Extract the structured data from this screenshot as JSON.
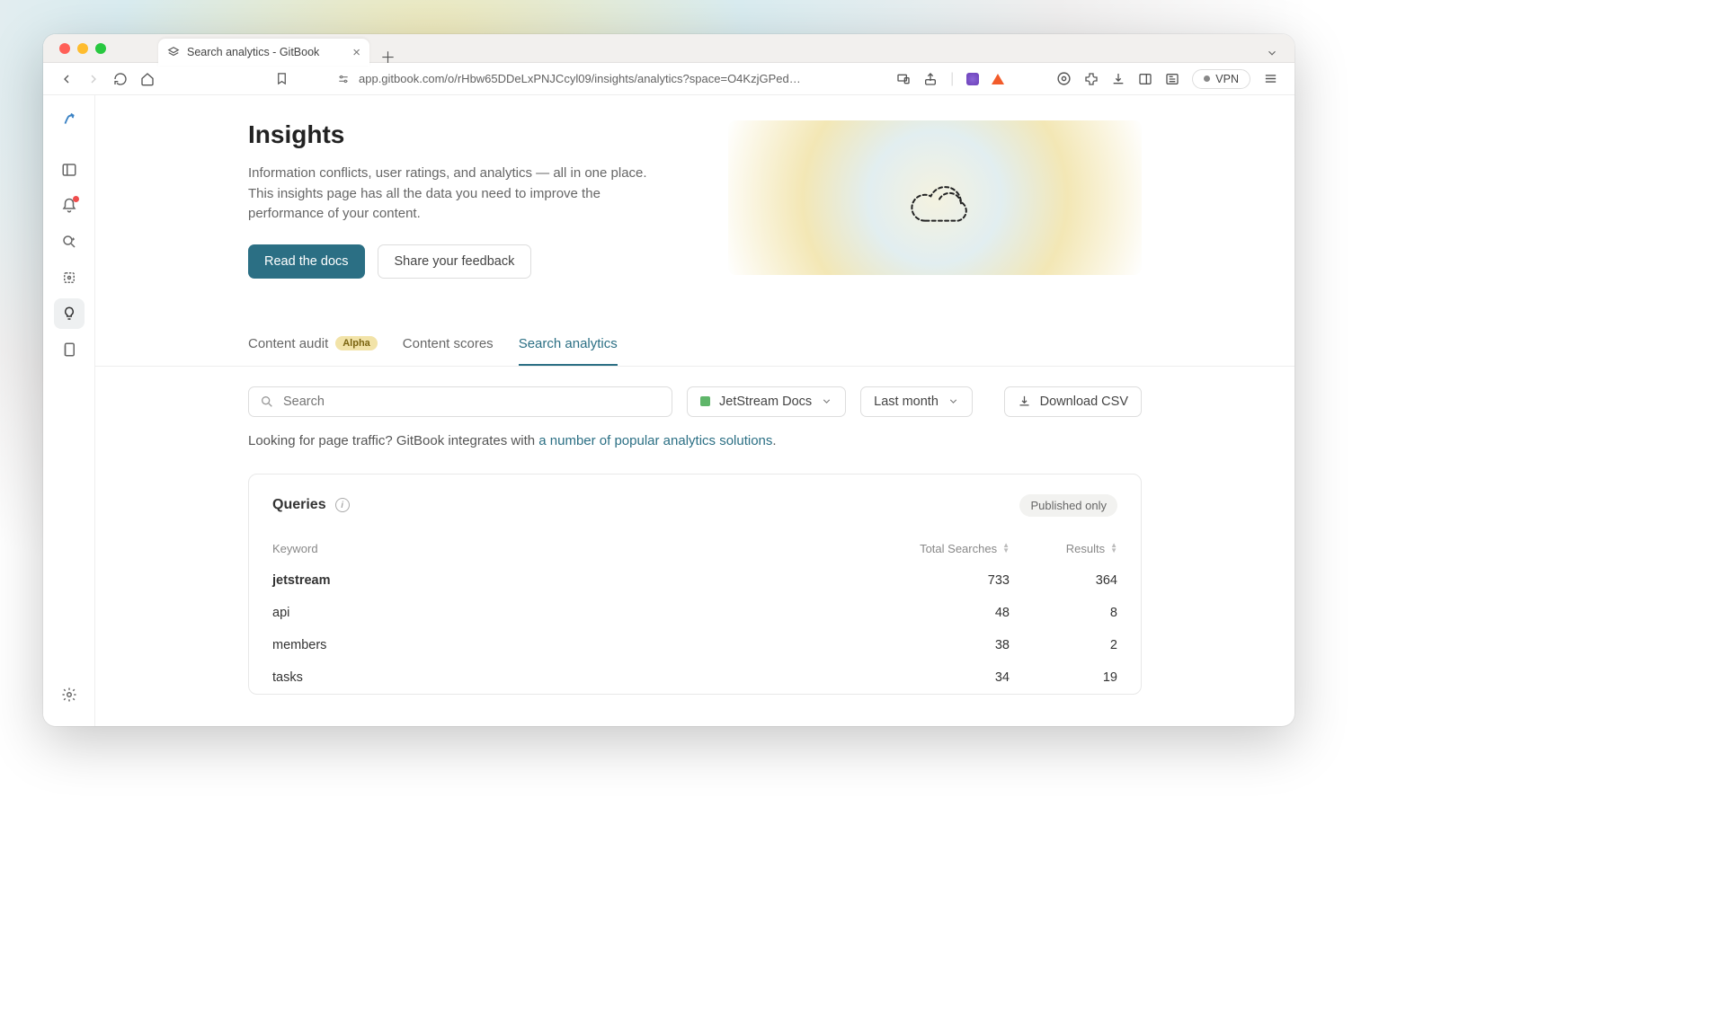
{
  "browser": {
    "tab_title": "Search analytics - GitBook",
    "url": "app.gitbook.com/o/rHbw65DDeLxPNJCcyl09/insights/analytics?space=O4KzjGPed…",
    "vpn": "VPN"
  },
  "hero": {
    "title": "Insights",
    "description": "Information conflicts, user ratings, and analytics — all in one place. This insights page has all the data you need to improve the performance of your content.",
    "primary_btn": "Read the docs",
    "secondary_btn": "Share your feedback"
  },
  "tabs": {
    "content_audit": "Content audit",
    "alpha": "Alpha",
    "content_scores": "Content scores",
    "search_analytics": "Search analytics"
  },
  "controls": {
    "search_placeholder": "Search",
    "space": "JetStream Docs",
    "period": "Last month",
    "download": "Download CSV"
  },
  "hint": {
    "prefix": "Looking for page traffic? GitBook integrates with ",
    "link": "a number of popular analytics solutions",
    "suffix": "."
  },
  "queries": {
    "title": "Queries",
    "published_badge": "Published only",
    "columns": {
      "keyword": "Keyword",
      "total": "Total Searches",
      "results": "Results"
    },
    "rows": [
      {
        "keyword": "jetstream",
        "total": "733",
        "results": "364"
      },
      {
        "keyword": "api",
        "total": "48",
        "results": "8"
      },
      {
        "keyword": "members",
        "total": "38",
        "results": "2"
      },
      {
        "keyword": "tasks",
        "total": "34",
        "results": "19"
      }
    ]
  }
}
